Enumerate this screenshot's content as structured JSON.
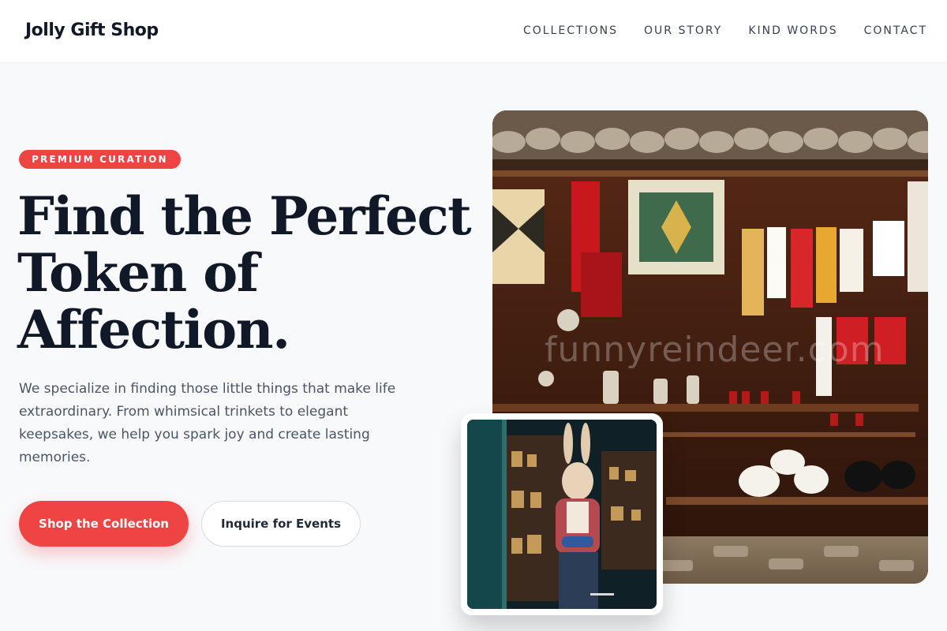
{
  "header": {
    "logo": "Jolly Gift Shop",
    "nav": [
      "COLLECTIONS",
      "OUR STORY",
      "KIND WORDS",
      "CONTACT"
    ]
  },
  "hero": {
    "badge": "PREMIUM CURATION",
    "headline": [
      "Find the Perfect",
      "Token of",
      "Affection."
    ],
    "lede": "We specialize in finding those little things that make life extraordinary. From whimsical trinkets to elegant keepsakes, we help you spark joy and create lasting memories.",
    "primary_cta": "Shop the Collection",
    "secondary_cta": "Inquire for Events"
  },
  "images": {
    "main_watermark": "funnyreindeer.com"
  },
  "colors": {
    "accent": "#ef4444",
    "heading": "#111827",
    "body_text": "#4b5563",
    "background": "#f8f9fb"
  }
}
